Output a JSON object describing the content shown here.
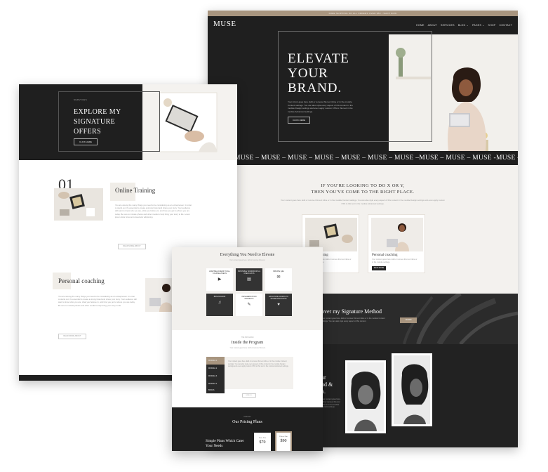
{
  "right": {
    "topbar_text": "FREE SHIPPING ON ALL ORDERS OVER $50 • SHOP NOW",
    "logo": "MUSE",
    "nav": [
      "HOME",
      "ABOUT",
      "SERVICES",
      "BLOG ⌄",
      "PAGES ⌄",
      "SHOP",
      "CONTACT"
    ],
    "hero": {
      "title_l1": "ELEVATE",
      "title_l2": "YOUR",
      "title_l3": "BRAND.",
      "copy": "Your intro's goes here. Edit or remove this text inline or in the module Content settings. You can also style every aspect of this content in the module Design settings and even apply custom CSS to this text in the module Advanced settings.",
      "button": "CLICK HERE"
    },
    "marquee": "MUSE – MUSE – MUSE – MUSE – MUSE – MUSE – MUSE – MUSE –MUSE – MUSE – MUSE -MUSE – MUSE – MUSE – MUSE –",
    "intro": {
      "heading_l1": "IF YOU'RE LOOKING TO DO X OR Y,",
      "heading_l2": "THEN YOU'VE COME TO THE RIGHT PLACE.",
      "copy": "Your content goes here. Edit or remove this text inline or in the module Content settings. You can also style every aspect of this content in the module Design settings and even apply custom CSS to this text in the module Advanced settings."
    },
    "cards": [
      {
        "title": "Online Training",
        "text": "Your content goes here. Edit or remove this text inline or in the module settings.",
        "button": "READ MORE"
      },
      {
        "title": "Personal coaching",
        "text": "Your content goes here. Edit or remove this text inline or in the module settings.",
        "button": "READ MORE"
      }
    ],
    "method": {
      "heading": "over my Signature Method",
      "text": "Your content goes here. Edit or remove this text inline or in the module Content settings. You can also style every aspect of this content.",
      "button": "LEARN"
    },
    "about": {
      "heading": "ur\nnd &\nh.",
      "text": "Your content goes here. Edit or remove this text inline or in the module Content settings."
    }
  },
  "left": {
    "kicker": "SERVICES",
    "title_l1": "EXPLORE MY",
    "title_l2": "SIGNATURE",
    "title_l3": "OFFERS",
    "button": "CLICK HERE",
    "number": "01",
    "s1_title": "Online Training",
    "s1_text": "You are among the many things you need to be considering as an entrepreneur. In order to stand out, it's essential to create a strong brand and share your story. Your audience will want to know who you are, what you believe in, and how you got to where you are today. Be sure to include photos and other media to help bring your story to life. Lorem ipsum dolor sit amet consectetur adipiscing.",
    "s1_button": "READ MORE ABOUT",
    "s2_title": "Personal coaching",
    "s2_text": "You are among the many things you need to be considering as an entrepreneur. In order to stand out, it's essential to create a strong brand and share your story. Your audience will want to know who you are, what you believe in, and how you got to where you are today. Be sure to include photos and other media to help bring your story to life.",
    "s2_button": "READ MORE ABOUT"
  },
  "center": {
    "grid_title": "Everything You Need to Elevate",
    "grid_sub": "Your content goes here. Edit or remove this text.",
    "tiles": [
      {
        "label": "LIFETIME ACCESS TO ALL COURSE VIDEOS",
        "icon": "▶",
        "style": "light"
      },
      {
        "label": "PRINTABLE WORKBOOKS & CHECKLISTS",
        "icon": "▤",
        "style": "dark"
      },
      {
        "label": "PRIVATE Q&A",
        "icon": "✉",
        "style": "light"
      },
      {
        "label": "BONUS AUDIO",
        "icon": "♫",
        "style": "dark"
      },
      {
        "label": "IMPLEMENTATION PROJECTS",
        "icon": "✎",
        "style": "light"
      },
      {
        "label": "EXCLUSIVE ACCESS TO STORE DISCOUNTS",
        "icon": "♥",
        "style": "dark"
      }
    ],
    "prog_kicker": "THE PROGRAM",
    "prog_title": "Inside the Program",
    "prog_sub": "Your content goes here. Edit or remove this text.",
    "modules": [
      "MODULE 1",
      "MODULE 2",
      "MODULE 3",
      "MODULE 4",
      "BONUS"
    ],
    "module_text": "Your content goes here. Edit or remove this text inline or in the module Content settings. You can also style every aspect of this content in the module Design settings and even apply custom CSS to this text in the module Advanced settings.",
    "prog_button": "ENROLL",
    "pr_kicker": "PRICING",
    "pr_title": "Our Pricing Plans",
    "pr_heading": "Simple Plans Which Cater Your Needs",
    "plans": [
      {
        "name": "Basic Plan",
        "price": "$70"
      },
      {
        "name": "Deluxe Plan",
        "price": "$90"
      }
    ]
  }
}
